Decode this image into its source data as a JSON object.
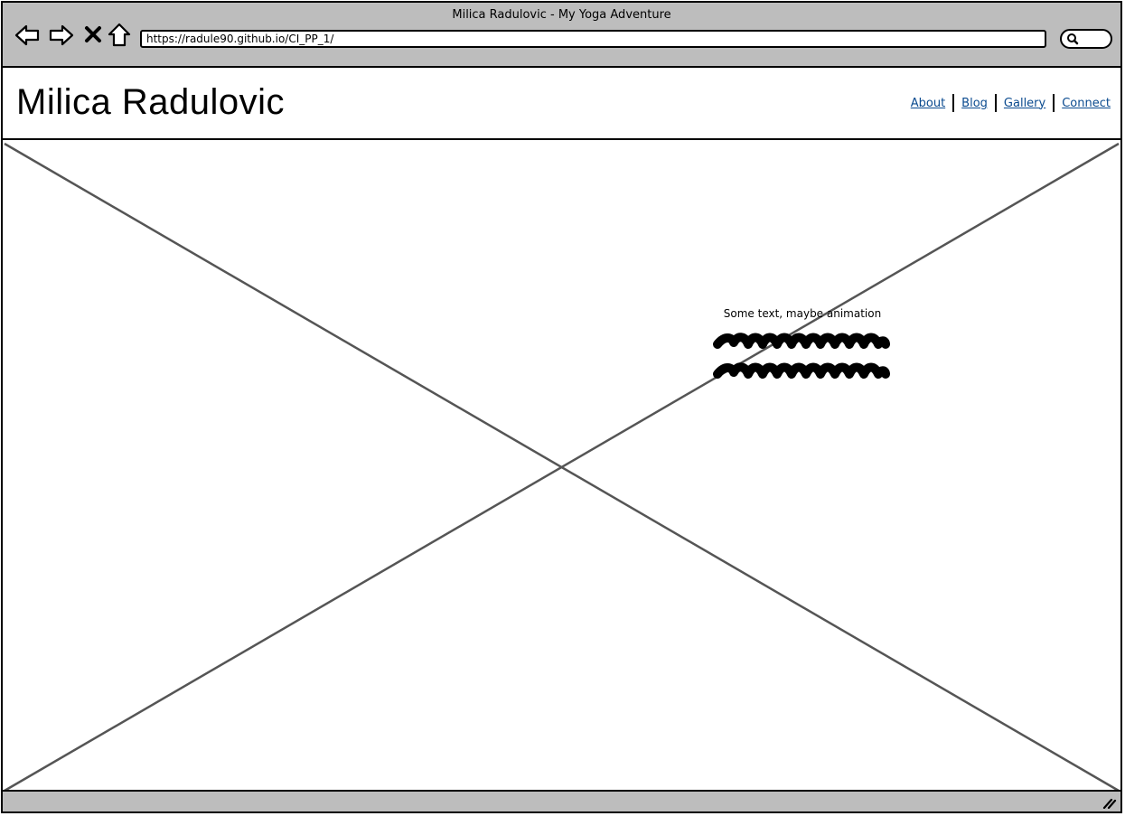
{
  "window": {
    "title": "Milica Radulovic - My Yoga Adventure",
    "url": "https://radule90.github.io/CI_PP_1/"
  },
  "toolbar": {
    "icons": [
      "back-arrow-icon",
      "forward-arrow-icon",
      "close-x-icon",
      "home-icon"
    ],
    "search_icon": "search-icon"
  },
  "header": {
    "title": "Milica Radulovic",
    "nav": [
      {
        "label": "About"
      },
      {
        "label": "Blog"
      },
      {
        "label": "Gallery"
      },
      {
        "label": "Connect"
      }
    ],
    "link_color": "#0a4a8f"
  },
  "hero": {
    "image_placeholder": "image-placeholder",
    "text": "Some text, maybe animation",
    "scribble_lines": 2
  },
  "colors": {
    "chrome": "#bdbdbd",
    "border": "#000000",
    "placeholder_lines": "#555555"
  }
}
